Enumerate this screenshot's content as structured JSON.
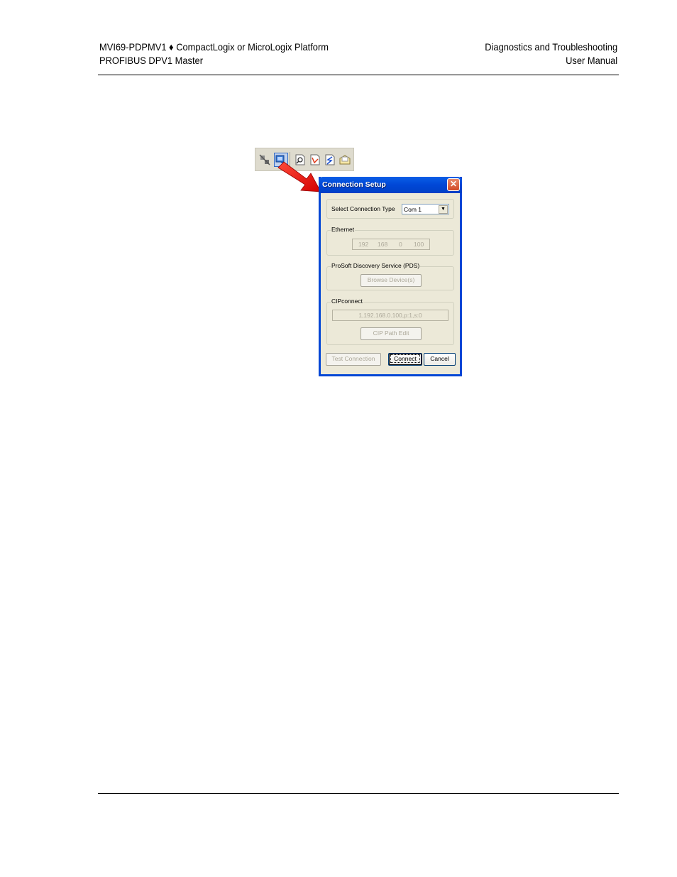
{
  "header": {
    "left_line1": "MVI69-PDPMV1 ♦ CompactLogix or MicroLogix Platform",
    "left_line2": "PROFIBUS DPV1 Master",
    "right_line1": "Diagnostics and Troubleshooting",
    "right_line2": "User Manual"
  },
  "colors": {
    "arrow": "#ee1111",
    "title_bar": "#0047d6",
    "dialog_face": "#ece9d8"
  },
  "toolbar": {
    "icons": [
      "disconnect-icon",
      "connection-setup-icon",
      "search-icon",
      "read-icon",
      "write-icon",
      "open-icon"
    ]
  },
  "dialog": {
    "title": "Connection Setup",
    "close_glyph": "✕",
    "select_type_label": "Select Connection Type",
    "connection_type_value": "Com 1",
    "dropdown_glyph": "▼",
    "ethernet": {
      "legend": "Ethernet",
      "ip": [
        "192",
        "168",
        "0",
        "100"
      ]
    },
    "pds": {
      "legend": "ProSoft Discovery Service (PDS)",
      "browse_label": "Browse Device(s)"
    },
    "cipconnect": {
      "legend": "CIPconnect",
      "path_value": "1,192.168.0.100,p:1,s:0",
      "path_edit_label": "CIP Path Edit"
    },
    "test_connection_label": "Test Connection",
    "connect_label": "Connect",
    "cancel_label": "Cancel"
  }
}
